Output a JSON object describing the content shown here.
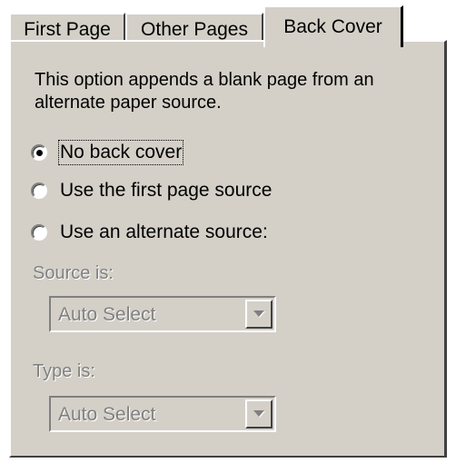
{
  "tabs": [
    {
      "label": "First Page"
    },
    {
      "label": "Other Pages"
    },
    {
      "label": "Back Cover",
      "active": true
    }
  ],
  "description": "This option appends a blank page from an alternate paper source.",
  "options": [
    {
      "label": "No back cover",
      "selected": true
    },
    {
      "label": "Use the first page source",
      "selected": false
    },
    {
      "label": "Use an alternate source:",
      "selected": false
    }
  ],
  "source": {
    "label": "Source is:",
    "value": "Auto Select",
    "enabled": false
  },
  "type": {
    "label": "Type is:",
    "value": "Auto Select",
    "enabled": false
  },
  "colors": {
    "face": "#d4d0c8",
    "disabled_text": "#808080"
  },
  "icons": {
    "dropdown": "chevron-down-icon"
  }
}
